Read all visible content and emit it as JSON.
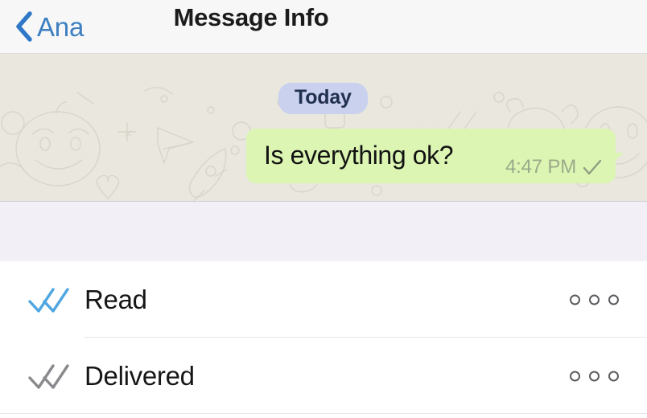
{
  "navbar": {
    "back_label": "Ana",
    "back_icon": "chevron-left-icon",
    "title": "Message Info",
    "accent_color": "#3d7fc1"
  },
  "chat": {
    "date_separator": "Today",
    "wallpaper_color": "#e9e7de",
    "message": {
      "text": "Is everything ok?",
      "time": "4:47 PM",
      "status_icon": "single-check-icon",
      "bubble_color": "#dcf5b3",
      "outgoing": true
    }
  },
  "info_list": {
    "rows": [
      {
        "label": "Read",
        "icon": "double-check-blue-icon",
        "icon_color": "#4fa6e0",
        "trailing_icon": "three-circles-icon"
      },
      {
        "label": "Delivered",
        "icon": "double-check-gray-icon",
        "icon_color": "#8a8a8e",
        "trailing_icon": "three-circles-icon"
      }
    ],
    "trailing_dot_count": 3
  }
}
